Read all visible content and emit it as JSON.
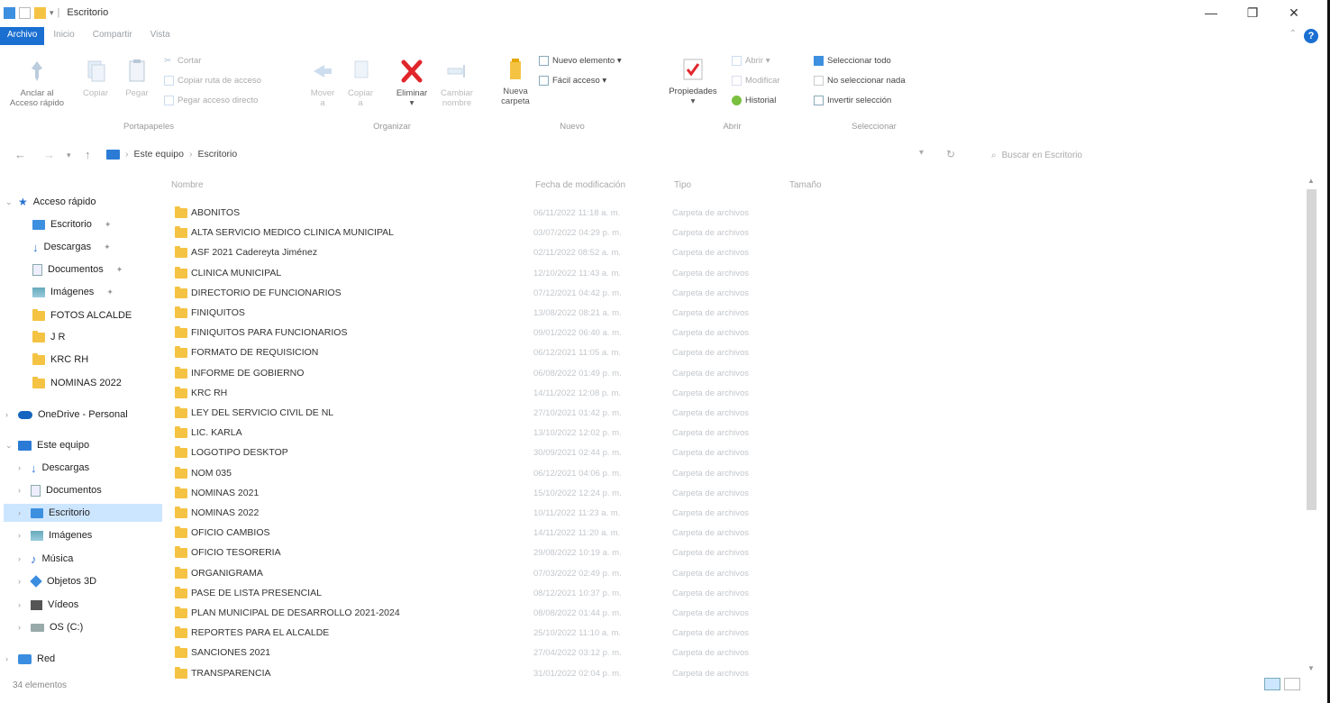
{
  "window": {
    "title": "Escritorio",
    "min": "—",
    "max": "❐",
    "close": "✕"
  },
  "ribbon_tabs": [
    "Archivo",
    "Inicio",
    "Compartir",
    "Vista"
  ],
  "ribbon": {
    "portapapeles": {
      "label": "Portapapeles",
      "pin": "Anclar al\nAcceso rápido",
      "copy": "Copiar",
      "paste": "Pegar",
      "cut": "Cortar",
      "copy_path": "Copiar ruta de acceso",
      "paste_shortcut": "Pegar acceso directo"
    },
    "organizar": {
      "label": "Organizar",
      "move": "Mover\na",
      "copy_to": "Copiar\na",
      "delete": "Eliminar",
      "rename": "Cambiar\nnombre"
    },
    "nuevo": {
      "label": "Nuevo",
      "new_folder": "Nueva\ncarpeta",
      "new_item": "Nuevo elemento ▾",
      "easy_access": "Fácil acceso ▾"
    },
    "abrir": {
      "label": "Abrir",
      "properties": "Propiedades",
      "open": "Abrir ▾",
      "edit": "Modificar",
      "history": "Historial"
    },
    "seleccionar": {
      "label": "Seleccionar",
      "select_all": "Seleccionar todo",
      "select_none": "No seleccionar nada",
      "invert": "Invertir selección"
    }
  },
  "address": {
    "crumbs": [
      "Este equipo",
      "Escritorio"
    ],
    "search_placeholder": "Buscar en Escritorio"
  },
  "nav": {
    "quick": "Acceso rápido",
    "quick_items": [
      "Escritorio",
      "Descargas",
      "Documentos",
      "Imágenes",
      "FOTOS ALCALDE",
      "J R",
      "KRC RH",
      "NOMINAS 2022"
    ],
    "onedrive": "OneDrive - Personal",
    "pc": "Este equipo",
    "pc_items": [
      "Descargas",
      "Documentos",
      "Escritorio",
      "Imágenes",
      "Música",
      "Objetos 3D",
      "Vídeos",
      "OS (C:)"
    ],
    "network": "Red"
  },
  "columns": {
    "name": "Nombre",
    "date": "Fecha de modificación",
    "type": "Tipo",
    "size": "Tamaño"
  },
  "files": [
    {
      "name": "ABONITOS",
      "date": "06/11/2022 11:18 a. m.",
      "type": "Carpeta de archivos"
    },
    {
      "name": "ALTA SERVICIO MEDICO CLINICA MUNICIPAL",
      "date": "03/07/2022 04:29 p. m.",
      "type": "Carpeta de archivos"
    },
    {
      "name": "ASF 2021 Cadereyta Jiménez",
      "date": "02/11/2022 08:52 a. m.",
      "type": "Carpeta de archivos"
    },
    {
      "name": "CLINICA MUNICIPAL",
      "date": "12/10/2022 11:43 a. m.",
      "type": "Carpeta de archivos"
    },
    {
      "name": "DIRECTORIO DE FUNCIONARIOS",
      "date": "07/12/2021 04:42 p. m.",
      "type": "Carpeta de archivos"
    },
    {
      "name": "FINIQUITOS",
      "date": "13/08/2022 08:21 a. m.",
      "type": "Carpeta de archivos"
    },
    {
      "name": "FINIQUITOS PARA FUNCIONARIOS",
      "date": "09/01/2022 06:40 a. m.",
      "type": "Carpeta de archivos"
    },
    {
      "name": "FORMATO DE REQUISICION",
      "date": "06/12/2021 11:05 a. m.",
      "type": "Carpeta de archivos"
    },
    {
      "name": "INFORME DE GOBIERNO",
      "date": "06/08/2022 01:49 p. m.",
      "type": "Carpeta de archivos"
    },
    {
      "name": "KRC RH",
      "date": "14/11/2022 12:08 p. m.",
      "type": "Carpeta de archivos"
    },
    {
      "name": "LEY DEL SERVICIO CIVIL DE NL",
      "date": "27/10/2021 01:42 p. m.",
      "type": "Carpeta de archivos"
    },
    {
      "name": "LIC. KARLA",
      "date": "13/10/2022 12:02 p. m.",
      "type": "Carpeta de archivos"
    },
    {
      "name": "LOGOTIPO DESKTOP",
      "date": "30/09/2021 02:44 p. m.",
      "type": "Carpeta de archivos"
    },
    {
      "name": "NOM 035",
      "date": "06/12/2021 04:06 p. m.",
      "type": "Carpeta de archivos"
    },
    {
      "name": "NOMINAS 2021",
      "date": "15/10/2022 12:24 p. m.",
      "type": "Carpeta de archivos"
    },
    {
      "name": "NOMINAS 2022",
      "date": "10/11/2022 11:23 a. m.",
      "type": "Carpeta de archivos"
    },
    {
      "name": "OFICIO CAMBIOS",
      "date": "14/11/2022 11:20 a. m.",
      "type": "Carpeta de archivos"
    },
    {
      "name": "OFICIO TESORERIA",
      "date": "29/08/2022 10:19 a. m.",
      "type": "Carpeta de archivos"
    },
    {
      "name": "ORGANIGRAMA",
      "date": "07/03/2022 02:49 p. m.",
      "type": "Carpeta de archivos"
    },
    {
      "name": "PASE DE LISTA PRESENCIAL",
      "date": "08/12/2021 10:37 p. m.",
      "type": "Carpeta de archivos"
    },
    {
      "name": "PLAN MUNICIPAL DE DESARROLLO 2021-2024",
      "date": "08/08/2022 01:44 p. m.",
      "type": "Carpeta de archivos"
    },
    {
      "name": "REPORTES PARA EL ALCALDE",
      "date": "25/10/2022 11:10 a. m.",
      "type": "Carpeta de archivos"
    },
    {
      "name": "SANCIONES 2021",
      "date": "27/04/2022 03:12 p. m.",
      "type": "Carpeta de archivos"
    },
    {
      "name": "TRANSPARENCIA",
      "date": "31/01/2022 02:04 p. m.",
      "type": "Carpeta de archivos"
    }
  ],
  "status": "34 elementos"
}
